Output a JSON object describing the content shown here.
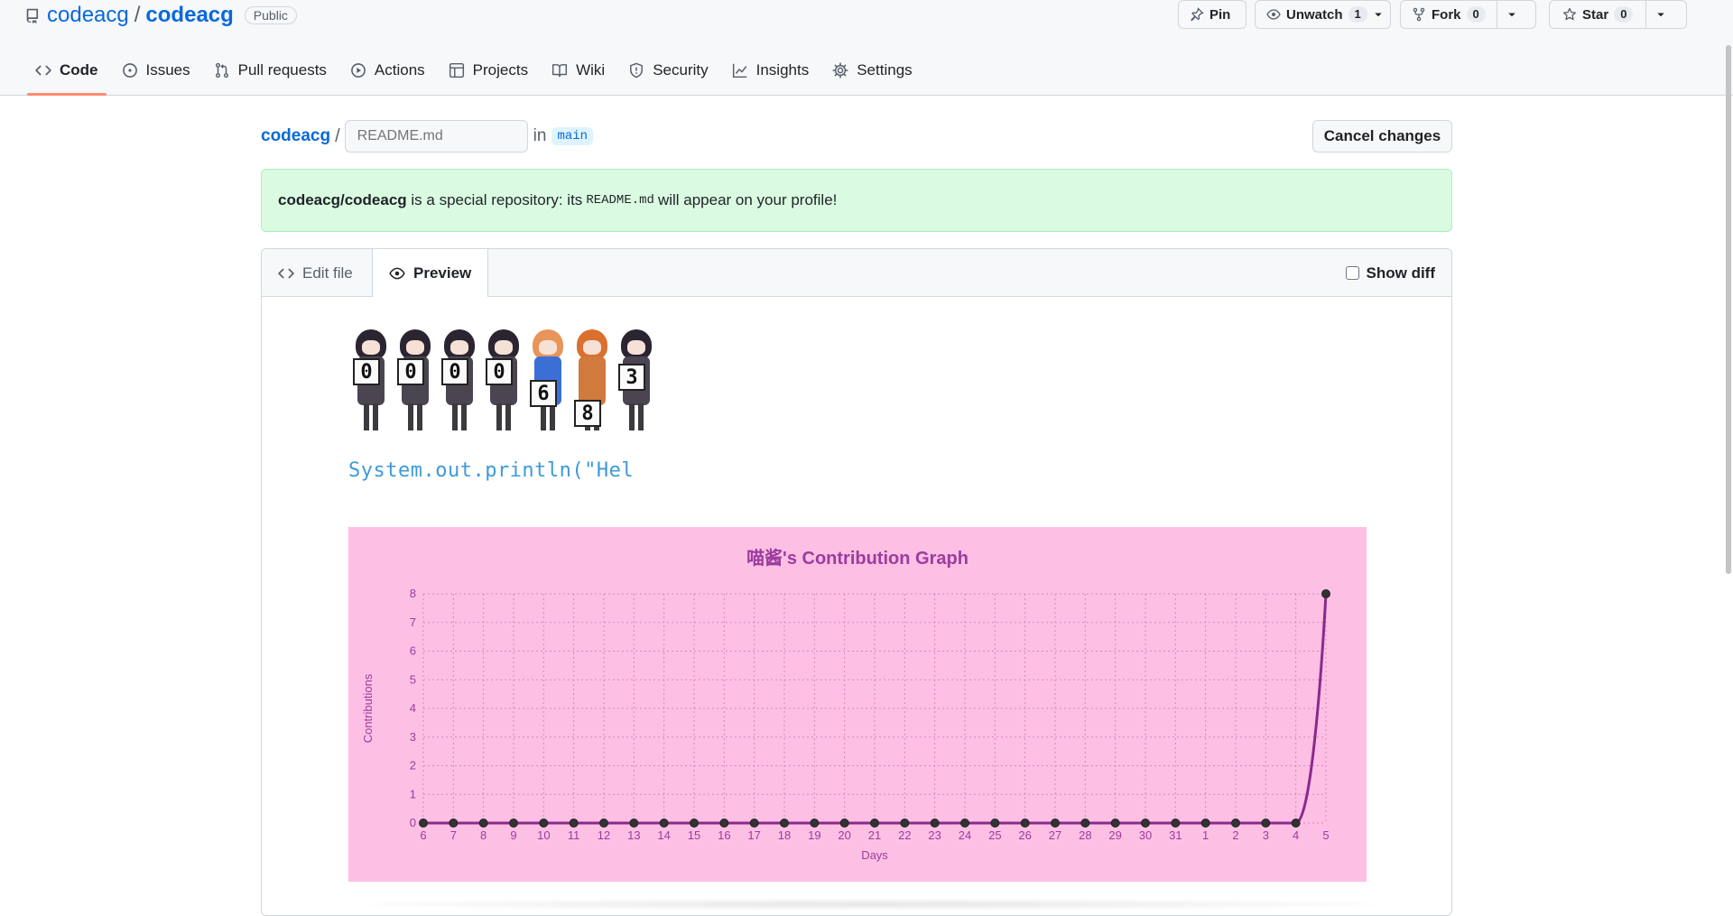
{
  "repo": {
    "owner": "codeacg",
    "separator": "/",
    "name": "codeacg",
    "visibility": "Public"
  },
  "header_buttons": {
    "pin_label": "Pin",
    "watch_label": "Unwatch",
    "watch_count": "1",
    "fork_label": "Fork",
    "fork_count": "0",
    "star_label": "Star",
    "star_count": "0"
  },
  "nav_tabs": [
    {
      "label": "Code",
      "icon": "code-icon",
      "active": true
    },
    {
      "label": "Issues",
      "icon": "issue-icon"
    },
    {
      "label": "Pull requests",
      "icon": "pull-request-icon"
    },
    {
      "label": "Actions",
      "icon": "play-icon"
    },
    {
      "label": "Projects",
      "icon": "table-icon"
    },
    {
      "label": "Wiki",
      "icon": "book-icon"
    },
    {
      "label": "Security",
      "icon": "shield-icon"
    },
    {
      "label": "Insights",
      "icon": "graph-icon"
    },
    {
      "label": "Settings",
      "icon": "gear-icon"
    }
  ],
  "editor": {
    "path_owner": "codeacg",
    "path_separator": "/",
    "filename_placeholder": "README.md",
    "in_word": "in",
    "branch": "main",
    "cancel_label": "Cancel changes",
    "notice": {
      "repo_ref": "codeacg/codeacg",
      "text_before_code": "is a special repository: its",
      "code": "README.md",
      "text_after_code": "will appear on your profile!"
    },
    "tabs": {
      "edit_label": "Edit file",
      "preview_label": "Preview"
    },
    "show_diff_label": "Show diff"
  },
  "preview": {
    "counter_digits": [
      "0",
      "0",
      "0",
      "0",
      "6",
      "8",
      "3"
    ],
    "code_line": "System.out.println(\"Hel"
  },
  "colors": {
    "chart_background": "#fdc0e4",
    "chart_line": "#8a2a8c",
    "chart_title": "#9b3c9e",
    "accent_tab": "#fd8c73",
    "link": "#0969da"
  },
  "chart_data": {
    "type": "line",
    "title": "喵酱's Contribution Graph",
    "xlabel": "Days",
    "ylabel": "Contributions",
    "categories": [
      "6",
      "7",
      "8",
      "9",
      "10",
      "11",
      "12",
      "13",
      "14",
      "15",
      "16",
      "17",
      "18",
      "19",
      "20",
      "21",
      "22",
      "23",
      "24",
      "25",
      "26",
      "27",
      "28",
      "29",
      "30",
      "31",
      "1",
      "2",
      "3",
      "4",
      "5"
    ],
    "values": [
      0,
      0,
      0,
      0,
      0,
      0,
      0,
      0,
      0,
      0,
      0,
      0,
      0,
      0,
      0,
      0,
      0,
      0,
      0,
      0,
      0,
      0,
      0,
      0,
      0,
      0,
      0,
      0,
      0,
      0,
      8
    ],
    "ylim": [
      0,
      8
    ],
    "yticks": [
      "0",
      "1",
      "2",
      "3",
      "4",
      "5",
      "6",
      "7",
      "8"
    ],
    "grid": true,
    "legend": "none"
  }
}
